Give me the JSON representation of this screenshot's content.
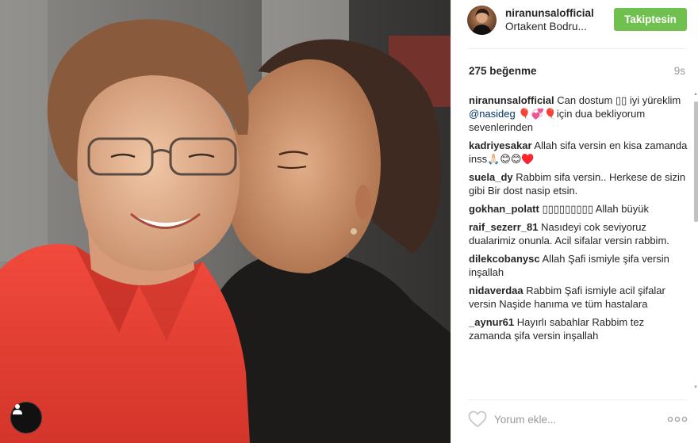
{
  "photo": {
    "alt_icon": "user-tag-icon"
  },
  "post": {
    "username": "niranunsalofficial",
    "location": "Ortakent Bodru...",
    "follow_label": "Takiptesin",
    "likes": "275 beğenme",
    "time_ago": "9s",
    "comment_placeholder": "Yorum ekle...",
    "accent_color": "#70c050",
    "mention_color": "#003569"
  },
  "comments": [
    {
      "user": "niranunsalofficial",
      "text_before": "Can dostum ▯▯ iyi yüreklim ",
      "mention": "@nasideg",
      "text_after": " 🎈💞🎈için dua bekliyorum sevenlerinden"
    },
    {
      "user": "kadriyesakar",
      "text_before": "Allah sifa versin en kisa zamanda inss🙏🏻😊😊♥️",
      "mention": "",
      "text_after": ""
    },
    {
      "user": "suela_dy",
      "text_before": "Rabbim sifa versin.. Herkese de sizin gibi Bir dost nasip etsin.",
      "mention": "",
      "text_after": ""
    },
    {
      "user": "gokhan_polatt",
      "text_before": "▯▯▯▯▯▯▯▯▯ Allah büyük",
      "mention": "",
      "text_after": ""
    },
    {
      "user": "raif_sezerr_81",
      "text_before": "Nasıdeyi cok seviyoruz dualarimiz onunla. Acil sifalar versin rabbim.",
      "mention": "",
      "text_after": ""
    },
    {
      "user": "dilekcobanysc",
      "text_before": "Allah Şafi ismiyle şifa versin inşallah",
      "mention": "",
      "text_after": ""
    },
    {
      "user": "nidaverdaa",
      "text_before": "Rabbim Şafi ismiyle acil şifalar versin Naşide hanıma ve tüm hastalara",
      "mention": "",
      "text_after": ""
    },
    {
      "user": "_aynur61",
      "text_before": "Hayırlı sabahlar Rabbim tez zamanda şifa versin inşallah",
      "mention": "",
      "text_after": ""
    }
  ]
}
